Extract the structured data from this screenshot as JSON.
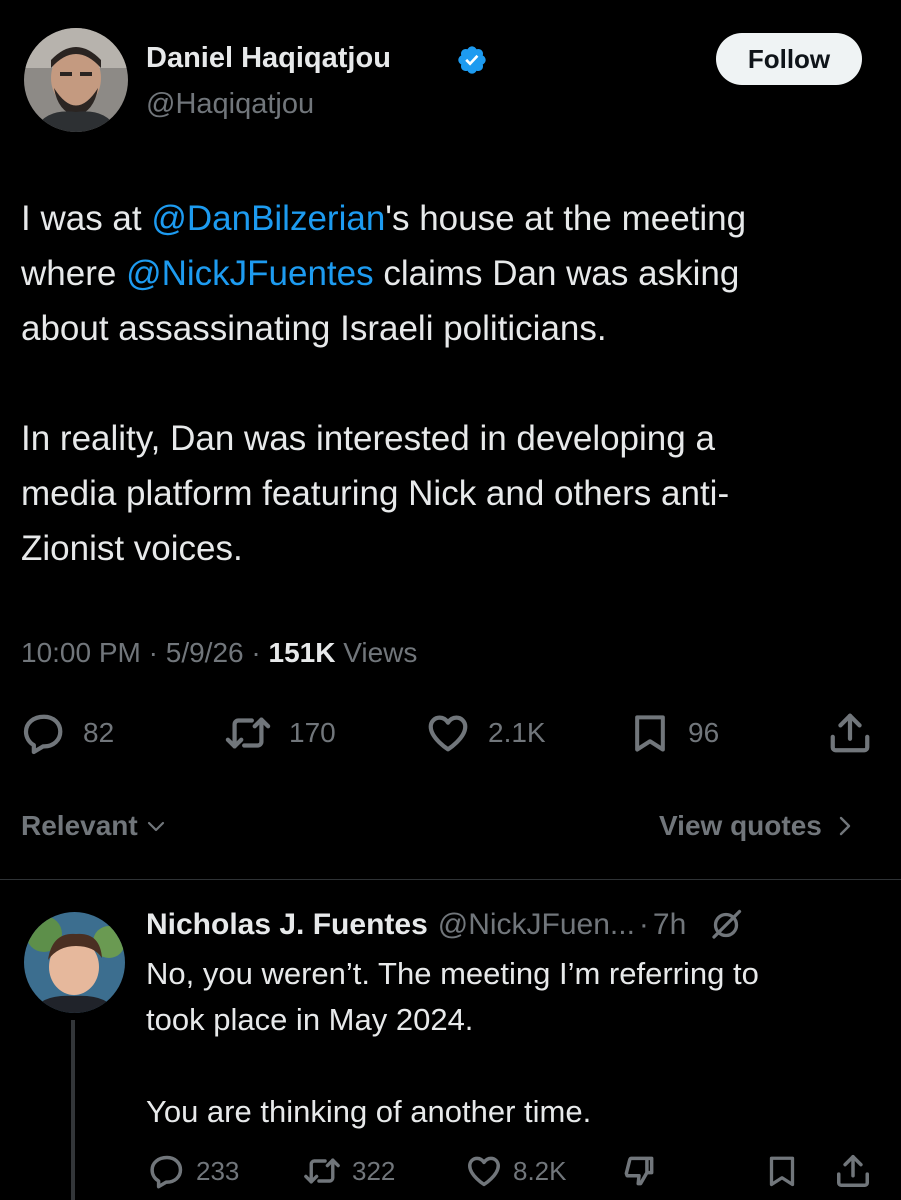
{
  "tweet": {
    "author": {
      "name": "Daniel Haqiqatjou",
      "handle": "@Haqiqatjou",
      "verified": true
    },
    "follow_label": "Follow",
    "body": {
      "p1_l1_pre": "I was at ",
      "p1_l1_mention": "@DanBilzerian",
      "p1_l1_post": "'s house at the meeting",
      "p1_l2_pre": "where ",
      "p1_l2_mention": "@NickJFuentes",
      "p1_l2_post": " claims Dan was asking",
      "p1_l3": "about assassinating Israeli politicians.",
      "p2_l1": "In reality, Dan was interested in developing a",
      "p2_l2": "media platform featuring Nick and others anti-",
      "p2_l3": "Zionist voices."
    },
    "time": "10:00 PM",
    "date": "5/9/26",
    "separator": "·",
    "views_count": "151K",
    "views_label": "Views",
    "stats": {
      "replies": "82",
      "reposts": "170",
      "likes": "2.1K",
      "bookmarks": "96"
    },
    "colors": {
      "background": "#000000",
      "text": "#e7e9ea",
      "muted": "#71767b",
      "link": "#1d9bf0",
      "verified": "#1d9bf0"
    }
  },
  "sort": {
    "label": "Relevant",
    "view_quotes": "View quotes"
  },
  "reply": {
    "name": "Nicholas J. Fuentes",
    "handle": "@NickJFuen...",
    "separator": "·",
    "time": "7h",
    "l1": "No, you weren’t. The meeting I’m referring to",
    "l2": "took place in May 2024.",
    "l3": "You are thinking of another time.",
    "stats": {
      "replies": "233",
      "reposts": "322",
      "likes": "8.2K"
    }
  }
}
